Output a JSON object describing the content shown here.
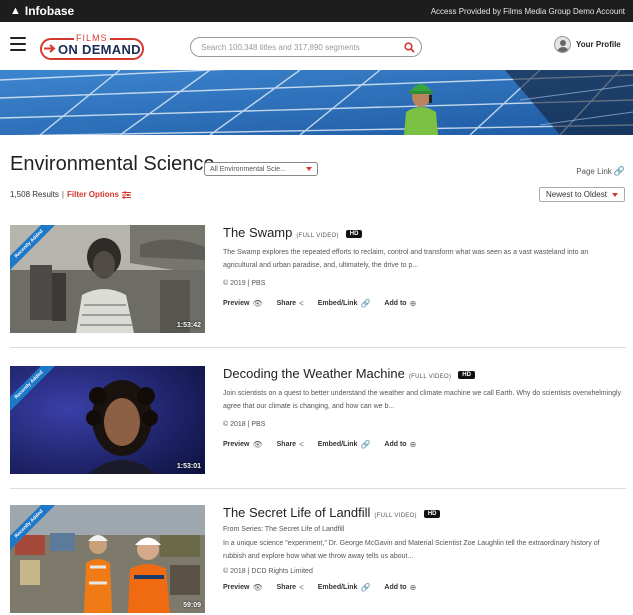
{
  "topbar": {
    "brand": "Infobase",
    "access_text": "Access Provided by Films Media Group Demo Account"
  },
  "header": {
    "logo_top": "FILMS",
    "logo_main": "ON DEMAND",
    "search_placeholder": "Search 100,348 titles and 317,890 segments",
    "profile_label": "Your Profile"
  },
  "page": {
    "title": "Environmental Science",
    "filter_select": "All Environmental Scie...",
    "page_link": "Page Link",
    "results_count": "1,508 Results",
    "results_sep": "|",
    "filter_options": "Filter Options",
    "sort": "Newest to Oldest"
  },
  "results": [
    {
      "title": "The Swamp",
      "tag": "(FULL VIDEO)",
      "hd": "HD",
      "series": "",
      "description": "The Swamp explores the repeated efforts to reclaim, control and transform what was seen as a vast wasteland into an agricultural and urban paradise, and, ultimately, the drive to p...",
      "meta": "© 2019 | PBS",
      "ribbon": "Recently Added",
      "duration": "1:53:42"
    },
    {
      "title": "Decoding the Weather Machine",
      "tag": "(FULL VIDEO)",
      "hd": "HD",
      "series": "",
      "description": "Join scientists on a quest to better understand the weather and climate machine we call Earth. Why do scientists overwhelmingly agree that our climate is changing, and how can we b...",
      "meta": "© 2018 | PBS",
      "ribbon": "Recently Added",
      "duration": "1:53:01"
    },
    {
      "title": "The Secret Life of Landfill",
      "tag": "(FULL VIDEO)",
      "hd": "HD",
      "series": "From Series: The Secret Life of Landfill",
      "description": "In a unique science \"experiment,\" Dr. George McGavin and Material Scientist Zoe Laughlin tell the extraordinary history of rubbish and explore how what we throw away tells us about...",
      "meta": "© 2018 | DCD Rights Limited",
      "ribbon": "Recently Added",
      "duration": "59:09"
    }
  ],
  "actions": {
    "preview": "Preview",
    "share": "Share",
    "embed": "Embed/Link",
    "add_to": "Add to"
  },
  "colors": {
    "accent": "#d4382f",
    "navy": "#1b2c56",
    "ribbon": "#1e78c8",
    "topbar": "#1d1d1d"
  }
}
